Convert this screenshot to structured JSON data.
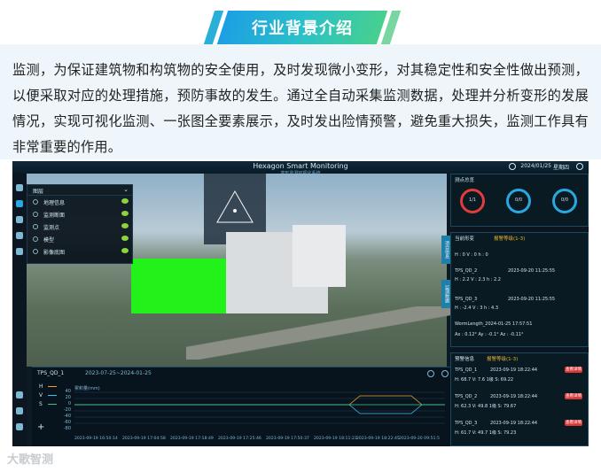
{
  "banner": {
    "title": "行业背景介绍",
    "colors": {
      "start": "#1c9fe4",
      "end": "#47d08e"
    }
  },
  "intro": {
    "text": "监测，为保证建筑物和构筑物的安全使用，及时发现微小变形，对其稳定性和安全性做出预测，以便采取对应的处理措施，预防事故的发生。通过全自动采集监测数据，处理并分析变形的发展情况，实现可视化监测、一张图全要素展示，及时发出险情预警，避免重大损失，监测工作具有非常重要的作用。"
  },
  "app": {
    "title": "Hexagon Smart Monitoring",
    "subtitle": "变形监测可视化系统",
    "date": "2024/01/25",
    "weekday": "星期四",
    "layers": {
      "header": "图层",
      "items": [
        {
          "label": "地理信息"
        },
        {
          "label": "监测断面"
        },
        {
          "label": "监测点"
        },
        {
          "label": "模型"
        },
        {
          "label": "影像底图"
        }
      ]
    },
    "bottom_chart": {
      "point": "TPS_QD_1",
      "range": "2023-07-25~2024-01-25",
      "unit": "累积量(mm)",
      "legend": [
        "H",
        "V",
        "S"
      ],
      "y_ticks": [
        "40",
        "20",
        "0",
        "-20",
        "-40",
        "-60",
        "-80"
      ],
      "x_ticks": [
        "2023-09-19 16:50:14",
        "2023-09-19 17:04:58",
        "2023-09-19 17:18:49",
        "2023-09-19 17:25:46",
        "2023-09-19 17:50:37",
        "2023-09-19 18:11:23",
        "2023-09-19 18:22:45",
        "2023-09-20 09:51:5"
      ],
      "colors": {
        "H": "#f0a030",
        "V": "#3cc0f0",
        "S": "#40c080"
      }
    },
    "overview": {
      "header": "测点总览",
      "gauges": [
        {
          "value": "1/1",
          "color": "#e23b3b"
        },
        {
          "value": "0/0",
          "color": "#2aa6e0"
        },
        {
          "value": "0/0",
          "color": "#2aa6e0"
        }
      ]
    },
    "change": {
      "header": "当前形变",
      "level_label": "报警等级(1-3)",
      "rows": [
        {
          "point": "",
          "time": "",
          "vals": "H : 0        V : 0        h : 0"
        },
        {
          "point": "TPS_QD_2",
          "time": "2023-09-20 11:25:55",
          "vals": "H : 2.2      V : 2.3      h : 2.2"
        },
        {
          "point": "TPS_QD_3",
          "time": "2023-09-20 11:25:55",
          "vals": "H : -2.4     V : 3        h : 4.3"
        },
        {
          "point": "WormLength_2024-01-25 17:57:51",
          "time": "",
          "vals": "Ax : 0.12°     Ay : -0.1°     Az : -0.11°"
        }
      ]
    },
    "alerts": {
      "header": "预警信息",
      "level_label": "报警等级(1-3)",
      "rows": [
        {
          "point": "TPS_QD_1",
          "time": "2023-09-19 18:22:44",
          "vals": "H: 68.7     V: 7.6     1级   S: 69.22",
          "btn": "查看详情"
        },
        {
          "point": "TPS_QD_2",
          "time": "2023-09-19 18:22:44",
          "vals": "H: 62.3     V: 49.8    1级   S: 79.67",
          "btn": "查看详情"
        },
        {
          "point": "TPS_QD_3",
          "time": "2023-09-19 18:22:44",
          "vals": "H: 61.7     V: 49.7    1级   S: 79.23",
          "btn": "查看详情"
        }
      ]
    },
    "side_tabs": [
      "项目信息",
      "监测数据"
    ]
  },
  "watermark": "大歌智测"
}
